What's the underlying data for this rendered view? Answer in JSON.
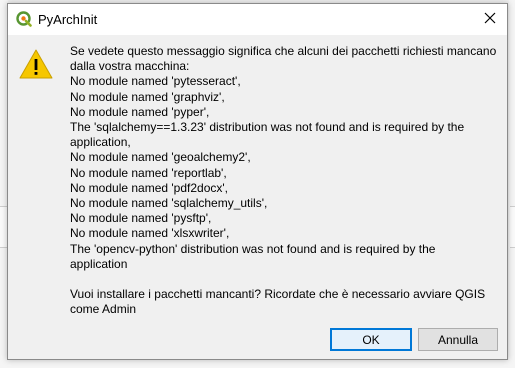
{
  "dialog": {
    "title": "PyArchInit",
    "message_lines": [
      "Se vedete questo messaggio significa che alcuni dei pacchetti richiesti mancano",
      "dalla vostra macchina:",
      "No module named 'pytesseract',",
      "No module named 'graphviz',",
      "No module named 'pyper',",
      "The 'sqlalchemy==1.3.23' distribution was not found and is required by the",
      "application,",
      "No module named 'geoalchemy2',",
      "No module named 'reportlab',",
      "No module named 'pdf2docx',",
      "No module named 'sqlalchemy_utils',",
      "No module named 'pysftp',",
      "No module named 'xlsxwriter',",
      "The 'opencv-python' distribution was not found and is required by the",
      "application"
    ],
    "question_lines": [
      "Vuoi installare i pacchetti mancanti? Ricordate che è necessario avviare QGIS",
      "come Admin"
    ],
    "ok_label": "OK",
    "cancel_label": "Annulla",
    "icons": {
      "app": "qgis-icon",
      "warning": "warning-icon",
      "close": "close-icon"
    }
  },
  "colors": {
    "warning_yellow": "#f6c700",
    "accent": "#0078d7"
  }
}
